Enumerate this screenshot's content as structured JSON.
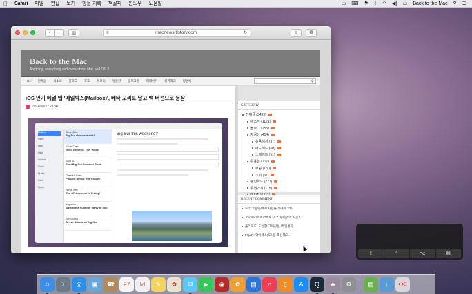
{
  "menubar": {
    "app": "Safari",
    "menus": [
      "파일",
      "편집",
      "보기",
      "방문 기록",
      "책갈피",
      "윈도우",
      "도움말"
    ],
    "user": "Back to the Mac"
  },
  "browser": {
    "url": "macnews.tistory.com"
  },
  "blog": {
    "title": "Back to the Mac",
    "subtitle": "Anything, everything and more about Mac and OS X.",
    "nav": [
      "Ho",
      "전체글",
      "시소식",
      "블로그",
      "포토",
      "위로리",
      "유용한",
      "블로그킹",
      "미래인기",
      "위키리크",
      "방명록"
    ],
    "post": {
      "title": "iOS 인기 메일 앱 '메일박스(Mailbox)', 베타 꼬리표 달고 맥 버전으로 등장",
      "date": "2014/08/27 21:47"
    },
    "mail_preview": {
      "sidebar": [
        "Mailbox",
        "Inbox",
        "Later",
        "Lists",
        "Archive",
        "Trash",
        "Drafts",
        "Sent",
        "Spam"
      ],
      "messages": [
        {
          "from": "Steve Jobs",
          "subject": "Big Sur this weekend?"
        },
        {
          "from": "Sarah Chen",
          "subject": "Need Reviews This Week"
        },
        {
          "from": "Scott M.",
          "subject": "First Big Sur Summer Spot"
        },
        {
          "from": "Cheerful Jones",
          "subject": "Potluck dinner this Friday!"
        },
        {
          "from": "Hunter Kim",
          "subject": "The SF weekend is Friday!"
        },
        {
          "from": "Maya Lee",
          "subject": "We have a Summer party to join"
        },
        {
          "from": "Jon Tanaka",
          "subject": "Arrive Atlanta at Big Sur"
        }
      ],
      "reading_title": "Big Sur this weekend?"
    },
    "sidebar": {
      "category_head": "CATEGORY",
      "categories": [
        {
          "label": "전체글 (3499)",
          "indent": 0
        },
        {
          "label": "애소식 (1121)",
          "indent": 1
        },
        {
          "label": "블로그 (255)",
          "indent": 1
        },
        {
          "label": "제공당 (454)",
          "indent": 1
        },
        {
          "label": "유용해서 (37)",
          "indent": 2
        },
        {
          "label": "애드해드 (60)",
          "indent": 2
        },
        {
          "label": "노메이드 (51)",
          "indent": 2
        },
        {
          "label": "유용함 (217)",
          "indent": 1
        },
        {
          "label": "부팅 (180)",
          "indent": 2
        },
        {
          "label": "조회 (37)",
          "indent": 2
        },
        {
          "label": "평안하드 (227)",
          "indent": 1
        },
        {
          "label": "유연가기 (115)",
          "indent": 1
        },
        {
          "label": "여디도우 (11)",
          "indent": 1
        }
      ],
      "recent_head": "RECENT COMMENT",
      "comments": [
        "모바: Figaty에서 사능롤 유대에 3키...",
        "Jbunter3GS:iOS X 10.7 이에한 맥 처음 f...",
        "플리포도: 도선한 그애같은 백 일론지...",
        "Figaty: 아이북스(도니): 조선해외..."
      ]
    }
  },
  "hud": {
    "keys": [
      "⇧",
      "^",
      "⌥",
      "⌘"
    ]
  },
  "dock": {
    "apps": [
      {
        "name": "Finder",
        "color": "#3d8ee6",
        "running": true
      },
      {
        "name": "Launchpad",
        "color": "#6c7a89",
        "running": false
      },
      {
        "name": "Safari",
        "color": "#2f8fe5",
        "running": true
      },
      {
        "name": "Preview",
        "color": "#6aa7d9",
        "running": false
      },
      {
        "name": "Contacts",
        "color": "#b08a5a",
        "running": false
      },
      {
        "name": "Calendar",
        "color": "#f5f5f5",
        "running": false
      },
      {
        "name": "Reminders",
        "color": "#f0f0f0",
        "running": false
      },
      {
        "name": "Notes",
        "color": "#f4d35e",
        "running": false
      },
      {
        "name": "Photos",
        "color": "#e8e2d0",
        "running": false
      },
      {
        "name": "Messages",
        "color": "#5ac8fa",
        "running": true
      },
      {
        "name": "FaceTime",
        "color": "#34c759",
        "running": false
      },
      {
        "name": "Photo Booth",
        "color": "#b52a2a",
        "running": false
      },
      {
        "name": "iPhoto",
        "color": "#f0a030",
        "running": false
      },
      {
        "name": "Keynote",
        "color": "#2b74d8",
        "running": false
      },
      {
        "name": "iTunes",
        "color": "#ef3d55",
        "running": false
      },
      {
        "name": "iBooks",
        "color": "#f08c22",
        "running": false
      },
      {
        "name": "App Store",
        "color": "#1d8cf0",
        "running": false
      },
      {
        "name": "QuickTime",
        "color": "#1b2a3a",
        "running": true
      },
      {
        "name": "Mac Tips",
        "color": "#9a8b9e",
        "running": true
      },
      {
        "name": "System Preferences",
        "color": "#8e8e93",
        "running": false
      }
    ],
    "stack": [
      {
        "name": "Documents",
        "color": "#6ab04c"
      },
      {
        "name": "Downloads",
        "color": "#5b9bd5"
      },
      {
        "name": "Trash",
        "color": "#d8d8dc"
      }
    ]
  }
}
